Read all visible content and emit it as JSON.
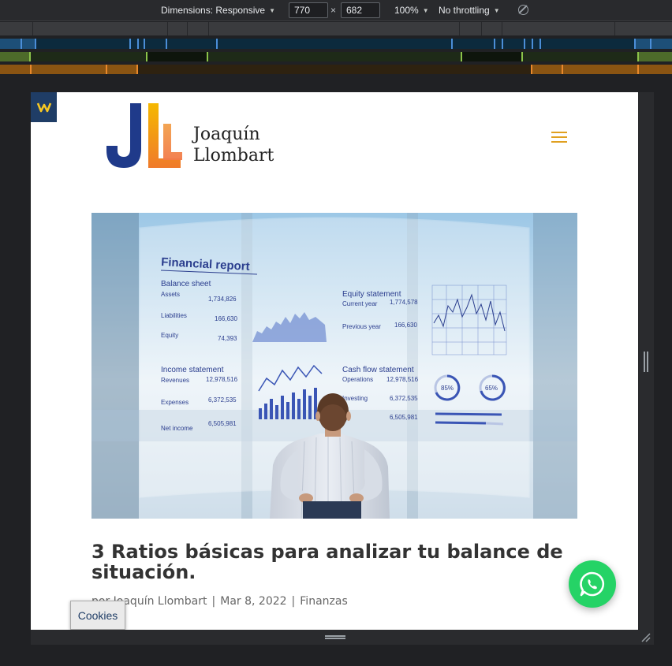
{
  "devtools": {
    "dimensions_label": "Dimensions: Responsive",
    "width_value": "770",
    "height_value": "682",
    "times_symbol": "×",
    "zoom": "100%",
    "throttling": "No throttling",
    "accent_colors": {
      "blue": "#1a73e8",
      "green": "#8bc34a",
      "orange": "#e8892c"
    }
  },
  "site": {
    "logo_line1": "Joaquín",
    "logo_line2": "Llombart",
    "menu_icon": "hamburger-icon",
    "menu_color": "#e0a020"
  },
  "post": {
    "title": "3 Ratios básicas para analizar tu balance de situación.",
    "meta_author": "por Joaquín Llombart",
    "meta_date": "Mar 8, 2022",
    "meta_category": "Finanzas",
    "separator": "|"
  },
  "hero_image": {
    "report_title": "Financial report",
    "balance_sheet": "Balance sheet",
    "assets": "Assets",
    "assets_value": "1,734,826",
    "liabilities": "Liabilities",
    "liabilities_value": "166,630",
    "equity": "Equity",
    "equity_value": "74,393",
    "income_statement": "Income statement",
    "revenues": "Revenues",
    "revenues_value": "12,978,516",
    "expenses": "Expenses",
    "expenses_value": "6,372,535",
    "net_income": "Net income",
    "net_income_value": "6,505,981",
    "equity_statement": "Equity statement",
    "current_year": "Current year",
    "current_year_value": "1,774,578",
    "previous_year": "Previous year",
    "previous_year_value": "166,630",
    "cash_flow": "Cash flow statement",
    "operations": "Operations",
    "operations_value": "12,978,516",
    "investing": "Investing",
    "investing_value": "6,372,535",
    "cf_total_value": "6,505,981",
    "donut1": "85%",
    "donut2": "65%"
  },
  "cookies": {
    "label": "Cookies"
  }
}
